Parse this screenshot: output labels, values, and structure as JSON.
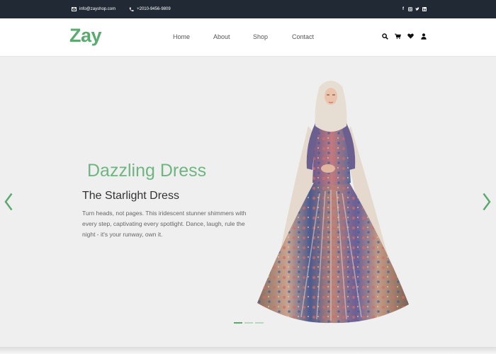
{
  "topbar": {
    "email": "info@zayshop.com",
    "phone": "+2010-9456-9809",
    "email_icon": "envelope-icon",
    "phone_icon": "phone-icon",
    "social_icons": [
      "facebook-icon",
      "instagram-icon",
      "twitter-icon",
      "linkedin-icon"
    ]
  },
  "nav": {
    "logo": "Zay",
    "menu": [
      "Home",
      "About",
      "Shop",
      "Contact"
    ],
    "icons": [
      "search-icon",
      "cart-icon",
      "heart-icon",
      "user-icon"
    ]
  },
  "hero": {
    "kicker": "Dazzling Dress",
    "title": "The Starlight Dress",
    "description": "Turn heads, not pages. This iridescent stunner shimmers with every step, captivating every spotlight. Dance, laugh, rule the night - it's your runway, own it.",
    "slide_count": 3,
    "active_slide": 1
  },
  "colors": {
    "brand": "#59ab6e",
    "topbar_bg": "#212934",
    "hero_bg": "#efefef"
  }
}
